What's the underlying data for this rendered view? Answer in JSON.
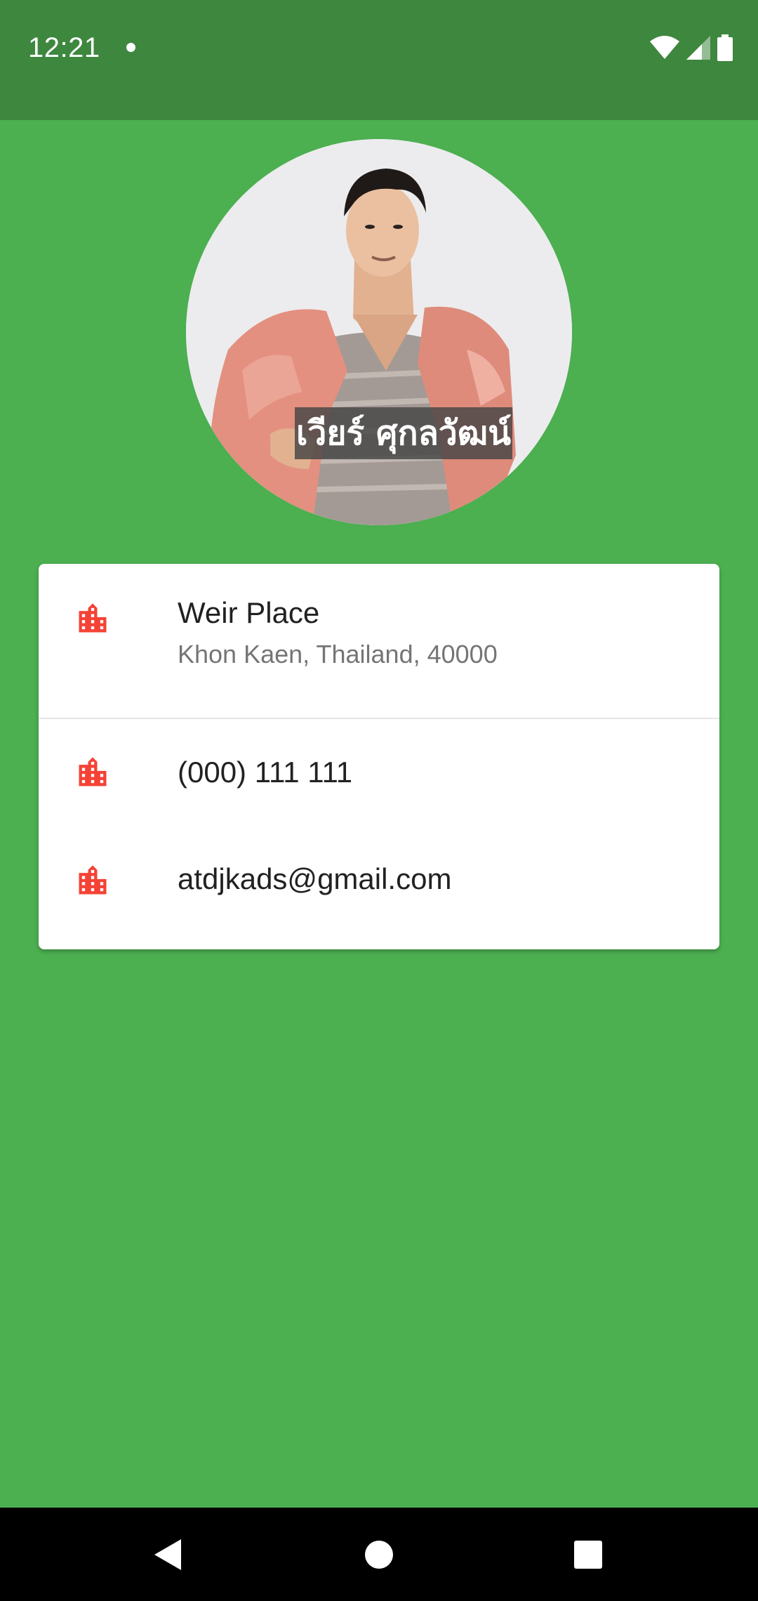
{
  "status_bar": {
    "time": "12:21",
    "icons": [
      "notification-dot-icon",
      "wifi-icon",
      "signal-icon",
      "battery-icon"
    ]
  },
  "profile": {
    "name_overlay": "เวียร์ ศุกลวัฒน์",
    "avatar": "profile-photo"
  },
  "card": {
    "address": {
      "icon": "building-icon",
      "title": "Weir Place",
      "subtitle": "Khon Kaen, Thailand, 40000"
    },
    "phone": {
      "icon": "building-icon",
      "value": "(000) 111 111"
    },
    "email": {
      "icon": "building-icon",
      "value": "atdjkads@gmail.com"
    }
  },
  "colors": {
    "background": "#4CAF50",
    "status_bar": "#3E873F",
    "icon_accent": "#F44336",
    "card": "#FFFFFF"
  },
  "nav_bar": {
    "buttons": [
      "back-icon",
      "home-icon",
      "recents-icon"
    ]
  }
}
